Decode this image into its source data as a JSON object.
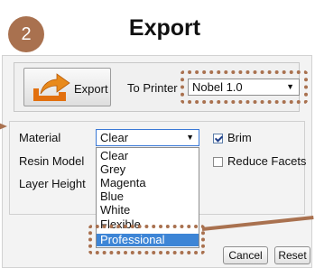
{
  "header": {
    "step_number": "2",
    "title": "Export"
  },
  "export_panel": {
    "export_button_label": "Export",
    "to_printer_label": "To Printer",
    "printer_value": "Nobel 1.0"
  },
  "settings": {
    "material_label": "Material",
    "material_value": "Clear",
    "resin_model_label": "Resin Model",
    "layer_height_label": "Layer Height",
    "brim_label": "Brim",
    "brim_checked": true,
    "reduce_facets_label": "Reduce Facets",
    "reduce_facets_checked": false
  },
  "material_dropdown": {
    "options": [
      "Clear",
      "Grey",
      "Magenta",
      "Blue",
      "White",
      "Flexible",
      "Professional"
    ],
    "highlighted": "Professional"
  },
  "footer": {
    "cancel_label": "Cancel",
    "reset_label": "Reset"
  },
  "colors": {
    "accent": "#a9714f",
    "selection": "#3d85d6"
  }
}
